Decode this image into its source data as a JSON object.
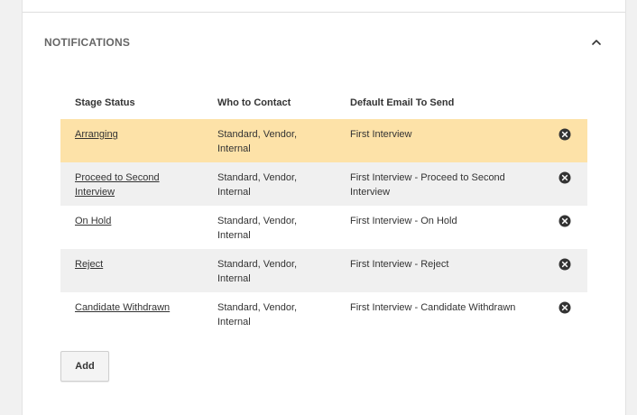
{
  "section": {
    "title": "NOTIFICATIONS",
    "collapse_icon": "chevron-up-icon"
  },
  "table": {
    "headers": {
      "stage_status": "Stage Status",
      "who_to_contact": "Who to Contact",
      "default_email": "Default Email To Send"
    },
    "rows": [
      {
        "stage_status": "Arranging",
        "who_to_contact": "Standard, Vendor, Internal",
        "default_email": "First Interview",
        "remove_icon": "close-circle-icon"
      },
      {
        "stage_status": "Proceed to Second Interview",
        "who_to_contact": "Standard, Vendor, Internal",
        "default_email": "First Interview - Proceed to Second Interview",
        "remove_icon": "close-circle-icon"
      },
      {
        "stage_status": "On Hold",
        "who_to_contact": "Standard, Vendor, Internal",
        "default_email": "First Interview - On Hold",
        "remove_icon": "close-circle-icon"
      },
      {
        "stage_status": "Reject",
        "who_to_contact": "Standard, Vendor, Internal",
        "default_email": "First Interview - Reject",
        "remove_icon": "close-circle-icon"
      },
      {
        "stage_status": "Candidate Withdrawn",
        "who_to_contact": "Standard, Vendor, Internal",
        "default_email": "First Interview - Candidate Withdrawn",
        "remove_icon": "close-circle-icon"
      }
    ]
  },
  "actions": {
    "add_label": "Add"
  },
  "colors": {
    "highlight_row": "#fde2a8",
    "shaded_row": "#f0f0f0",
    "icon": "#333333"
  }
}
